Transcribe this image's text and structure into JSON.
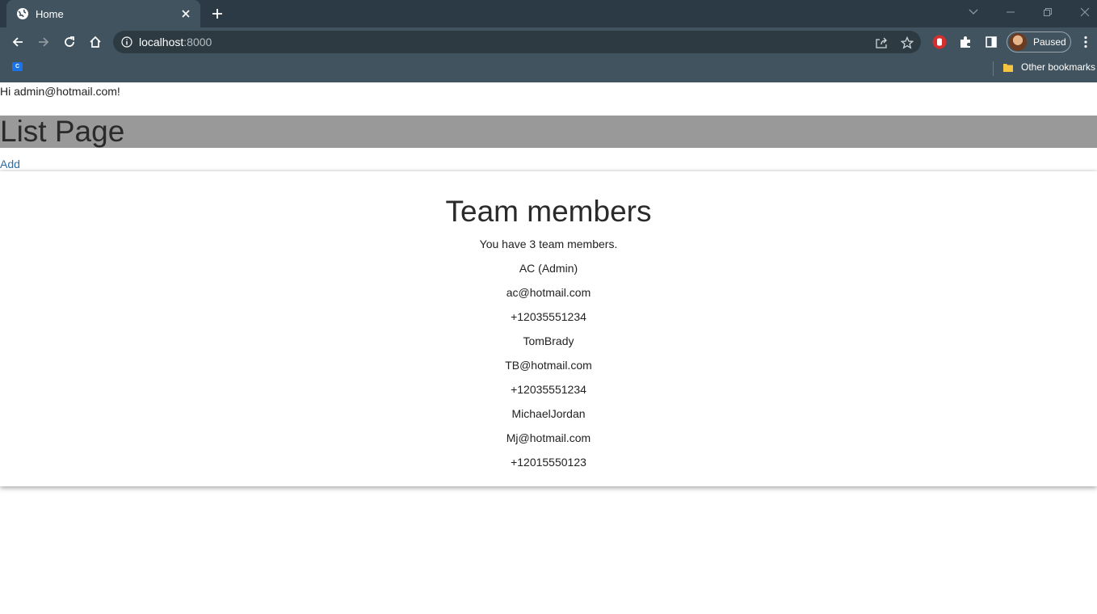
{
  "browser": {
    "tab_title": "Home",
    "url_host": "localhost",
    "url_port": ":8000",
    "profile_label": "Paused",
    "bookmark_favicon_letter": "C",
    "other_bookmarks": "Other bookmarks"
  },
  "page": {
    "greeting": "Hi admin@hotmail.com!",
    "title": "List Page",
    "add_link": "Add",
    "team": {
      "heading": "Team members",
      "count_text": "You have 3 team members.",
      "members": [
        {
          "name": "AC (Admin)",
          "email": "ac@hotmail.com",
          "phone": "+12035551234"
        },
        {
          "name": "TomBrady",
          "email": "TB@hotmail.com",
          "phone": "+12035551234"
        },
        {
          "name": "MichaelJordan",
          "email": "Mj@hotmail.com",
          "phone": "+12015550123"
        }
      ]
    }
  },
  "colors": {
    "tab_strip": "#2b3a44",
    "toolbar": "#41535e",
    "banner": "#999999",
    "link": "#2a6fa8"
  }
}
